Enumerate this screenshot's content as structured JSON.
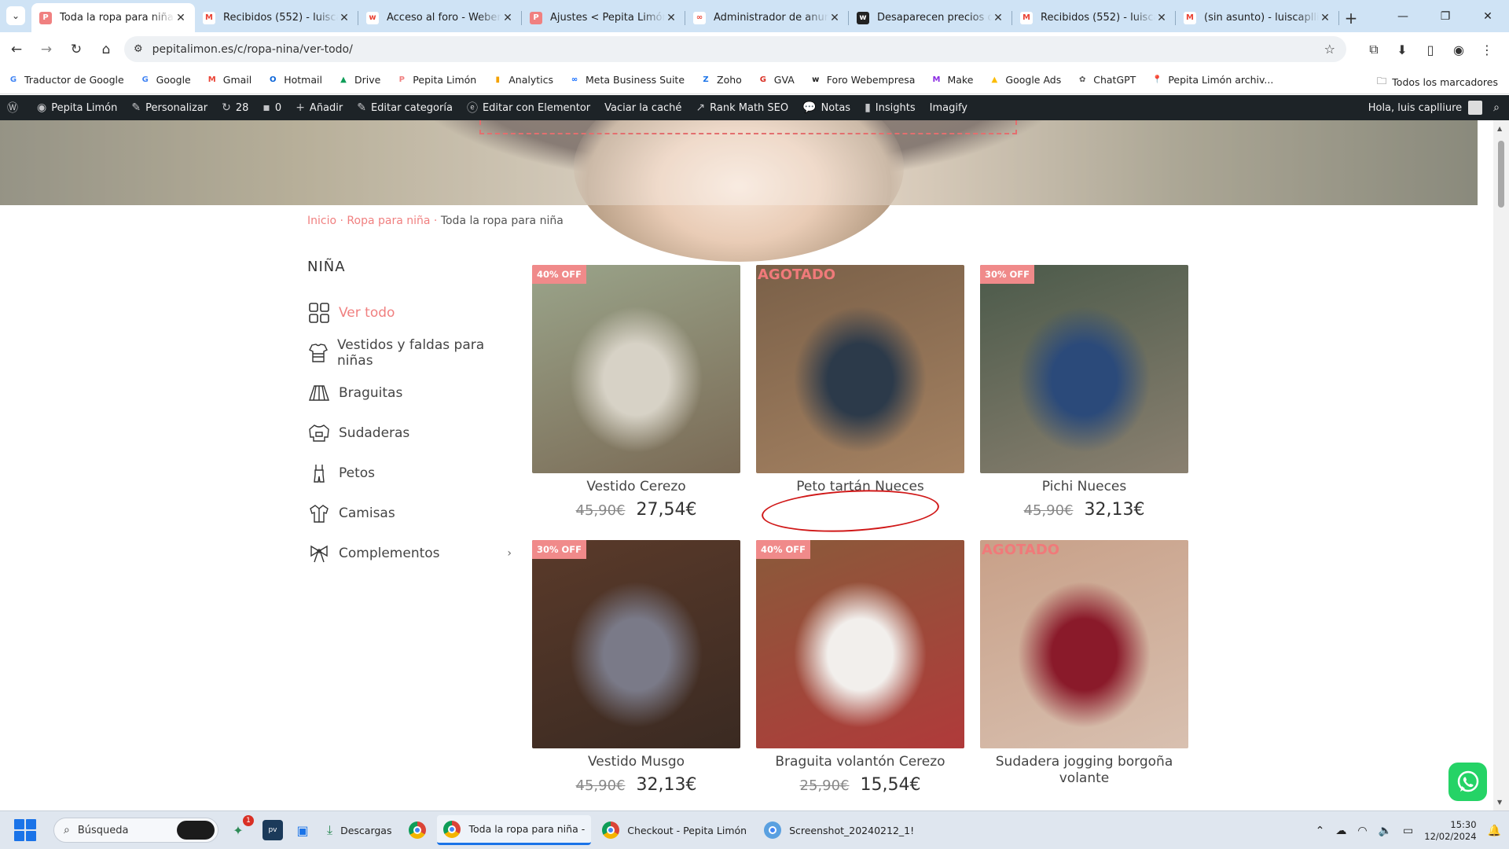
{
  "browser": {
    "tabs": [
      {
        "title": "Toda la ropa para niña - P",
        "icon_color": "#f08080",
        "icon_glyph": "P",
        "active": true
      },
      {
        "title": "Recibidos (552) - luiscapll",
        "icon_color": "#ffffff",
        "icon_glyph": "M",
        "active": false
      },
      {
        "title": "Acceso al foro - Webemp",
        "icon_color": "#ffffff",
        "icon_glyph": "w",
        "active": false
      },
      {
        "title": "Ajustes < Pepita Limón —",
        "icon_color": "#f08080",
        "icon_glyph": "P",
        "active": false
      },
      {
        "title": "Administrador de anuncio",
        "icon_color": "#ffffff",
        "icon_glyph": "∞",
        "active": false
      },
      {
        "title": "Desaparecen precios de l",
        "icon_color": "#222222",
        "icon_glyph": "w",
        "active": false
      },
      {
        "title": "Recibidos (552) - luiscapll",
        "icon_color": "#ffffff",
        "icon_glyph": "M",
        "active": false
      },
      {
        "title": "(sin asunto) - luiscaplliure",
        "icon_color": "#ffffff",
        "icon_glyph": "M",
        "active": false
      }
    ],
    "new_tab": "+",
    "window_controls": {
      "minimize": "—",
      "maximize": "❐",
      "close": "✕"
    },
    "nav": {
      "back": "←",
      "forward": "→",
      "reload": "↻",
      "home": "⌂"
    },
    "url": "pepitalimon.es/c/ropa-nina/ver-todo/",
    "star": "☆",
    "right_icons": [
      "⧉",
      "⬇",
      "▯",
      "◉",
      "⋮"
    ]
  },
  "bookmarks": {
    "items": [
      {
        "label": "Traductor de Google",
        "icon": "translate-icon",
        "color": "#4285f4",
        "glyph": "G"
      },
      {
        "label": "Google",
        "icon": "google-icon",
        "color": "#4285f4",
        "glyph": "G"
      },
      {
        "label": "Gmail",
        "icon": "gmail-icon",
        "color": "#ea4335",
        "glyph": "M"
      },
      {
        "label": "Hotmail",
        "icon": "outlook-icon",
        "color": "#0a64d8",
        "glyph": "O"
      },
      {
        "label": "Drive",
        "icon": "drive-icon",
        "color": "#0f9d58",
        "glyph": "▲"
      },
      {
        "label": "Pepita Limón",
        "icon": "pepita-icon",
        "color": "#f08080",
        "glyph": "P"
      },
      {
        "label": "Analytics",
        "icon": "analytics-icon",
        "color": "#f4a100",
        "glyph": "▮"
      },
      {
        "label": "Meta Business Suite",
        "icon": "meta-icon",
        "color": "#0866ff",
        "glyph": "∞"
      },
      {
        "label": "Zoho",
        "icon": "zoho-icon",
        "color": "#1a73e8",
        "glyph": "Z"
      },
      {
        "label": "GVA",
        "icon": "gva-icon",
        "color": "#d93025",
        "glyph": "G"
      },
      {
        "label": "Foro Webempresa",
        "icon": "webempresa-icon",
        "color": "#222222",
        "glyph": "w"
      },
      {
        "label": "Make",
        "icon": "make-icon",
        "color": "#8a2be2",
        "glyph": "M"
      },
      {
        "label": "Google Ads",
        "icon": "ads-icon",
        "color": "#fbbc04",
        "glyph": "▲"
      },
      {
        "label": "ChatGPT",
        "icon": "chatgpt-icon",
        "color": "#555555",
        "glyph": "✿"
      },
      {
        "label": "Pepita Limón archiv...",
        "icon": "pin-icon",
        "color": "#777777",
        "glyph": "📍"
      }
    ],
    "all_label": "Todos los marcadores"
  },
  "wp_admin": {
    "items": [
      {
        "label": "",
        "icon": "wordpress-icon",
        "glyph": "Ⓦ"
      },
      {
        "label": "Pepita Limón",
        "icon": "dashboard-icon",
        "glyph": "◉"
      },
      {
        "label": "Personalizar",
        "icon": "brush-icon",
        "glyph": "✎"
      },
      {
        "label": "28",
        "icon": "updates-icon",
        "glyph": "↻"
      },
      {
        "label": "0",
        "icon": "comments-icon",
        "glyph": "▪"
      },
      {
        "label": "Añadir",
        "icon": "plus-icon",
        "glyph": "+"
      },
      {
        "label": "Editar categoría",
        "icon": "edit-icon",
        "glyph": "✎"
      },
      {
        "label": "Editar con Elementor",
        "icon": "elementor-icon",
        "glyph": "ⓔ"
      },
      {
        "label": "Vaciar la caché",
        "icon": "",
        "glyph": ""
      },
      {
        "label": "Rank Math SEO",
        "icon": "rankmath-icon",
        "glyph": "↗"
      },
      {
        "label": "Notas",
        "icon": "notes-icon",
        "glyph": "💬"
      },
      {
        "label": "Insights",
        "icon": "insights-icon",
        "glyph": "▮"
      },
      {
        "label": "Imagify",
        "icon": "",
        "glyph": ""
      }
    ],
    "greeting": "Hola, luis caplliure"
  },
  "page": {
    "breadcrumb": {
      "home": "Inicio",
      "sep": " · ",
      "parent": "Ropa para niña",
      "current": "Toda la ropa para niña"
    },
    "sidebar_title": "NIÑA",
    "sidebar": [
      {
        "label": "Ver todo",
        "icon": "grid-icon",
        "active": true
      },
      {
        "label": "Vestidos y faldas para niñas",
        "icon": "dress-icon",
        "active": false
      },
      {
        "label": "Braguitas",
        "icon": "skirt-icon",
        "active": false
      },
      {
        "label": "Sudaderas",
        "icon": "sweatshirt-icon",
        "active": false
      },
      {
        "label": "Petos",
        "icon": "overalls-icon",
        "active": false
      },
      {
        "label": "Camisas",
        "icon": "shirt-icon",
        "active": false
      },
      {
        "label": "Complementos",
        "icon": "bow-icon",
        "active": false,
        "chevron": "›"
      }
    ],
    "products": [
      {
        "name": "Vestido Cerezo",
        "badge": "40% OFF",
        "sold_out": "",
        "old_price": "45,90€",
        "price": "27,54€",
        "colors": [
          "#9aa48a",
          "#d7d2c6",
          "#7a6a55"
        ]
      },
      {
        "name": "Peto tartán Nueces",
        "badge": "",
        "sold_out": "AGOTADO",
        "old_price": "",
        "price": "",
        "colors": [
          "#7a6048",
          "#2c3a4a",
          "#a58262"
        ]
      },
      {
        "name": "Pichi Nueces",
        "badge": "30% OFF",
        "sold_out": "",
        "old_price": "45,90€",
        "price": "32,13€",
        "colors": [
          "#4b5a4a",
          "#2b4a7a",
          "#8a8070"
        ]
      },
      {
        "name": "Vestido Musgo",
        "badge": "30% OFF",
        "sold_out": "",
        "old_price": "45,90€",
        "price": "32,13€",
        "colors": [
          "#5a3a2a",
          "#7a7a88",
          "#3a2a22"
        ]
      },
      {
        "name": "Braguita volantón Cerezo",
        "badge": "40% OFF",
        "sold_out": "",
        "old_price": "25,90€",
        "price": "15,54€",
        "colors": [
          "#8a5a3a",
          "#f2efec",
          "#b03a3a"
        ]
      },
      {
        "name": "Sudadera jogging borgoña volante",
        "badge": "",
        "sold_out": "AGOTADO",
        "old_price": "",
        "price": "",
        "colors": [
          "#c8a088",
          "#8a1a2a",
          "#d8c0b0"
        ]
      }
    ]
  },
  "taskbar": {
    "search_placeholder": "Búsqueda",
    "downloads": "Descargas",
    "apps": [
      {
        "label": "Toda la ropa para niña -",
        "active": true
      },
      {
        "label": "Checkout - Pepita Limón",
        "active": false
      },
      {
        "label": "Screenshot_20240212_1!",
        "active": false
      }
    ],
    "badge": "1",
    "time": "15:30",
    "date": "12/02/2024"
  }
}
